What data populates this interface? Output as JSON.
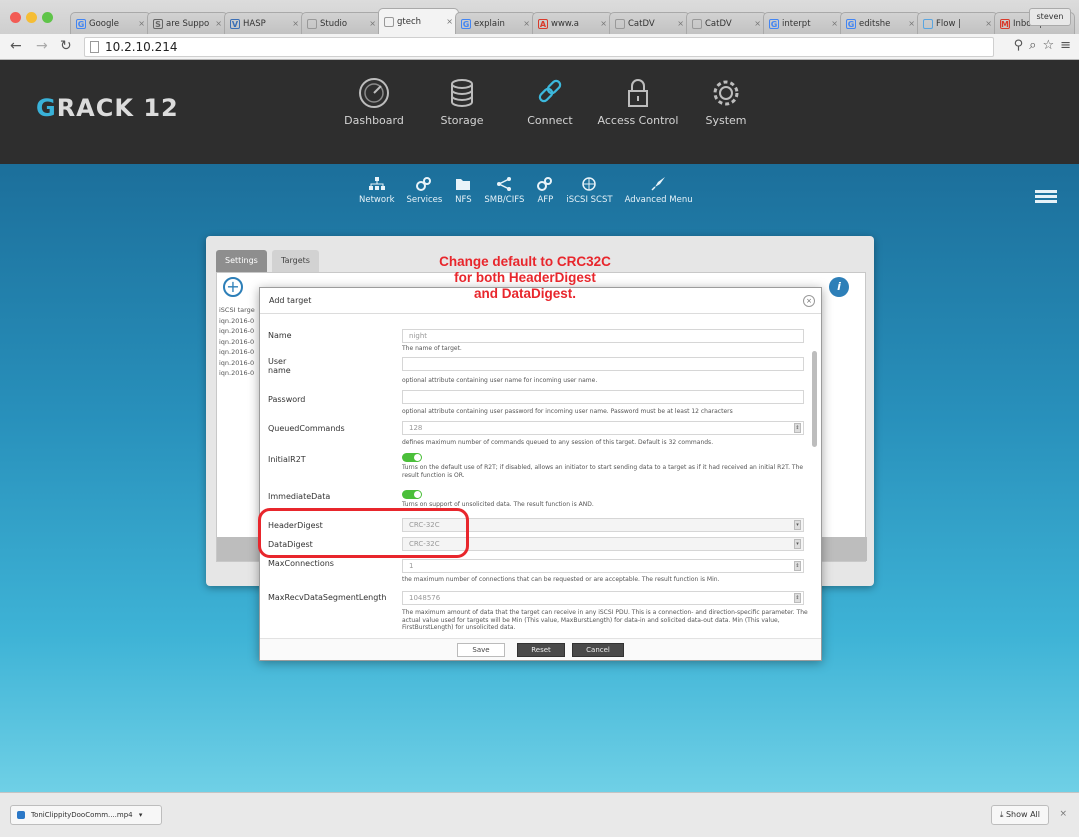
{
  "browser": {
    "tabs": [
      {
        "label": "Google",
        "fav": "G",
        "color": "#4285f4"
      },
      {
        "label": "are Suppo",
        "fav": "S",
        "color": "#666666"
      },
      {
        "label": "HASP",
        "fav": "V",
        "color": "#3b6fb6"
      },
      {
        "label": "Studio",
        "fav": "",
        "color": "#999999"
      },
      {
        "label": "gtech",
        "fav": "",
        "color": "#999999"
      },
      {
        "label": "explain",
        "fav": "G",
        "color": "#4285f4"
      },
      {
        "label": "www.a",
        "fav": "A",
        "color": "#d93a2b"
      },
      {
        "label": "CatDV",
        "fav": "",
        "color": "#999999"
      },
      {
        "label": "CatDV",
        "fav": "",
        "color": "#999999"
      },
      {
        "label": "interpt",
        "fav": "G",
        "color": "#4285f4"
      },
      {
        "label": "editshe",
        "fav": "G",
        "color": "#4285f4"
      },
      {
        "label": "Flow |",
        "fav": "",
        "color": "#5aa5e0"
      },
      {
        "label": "Inbox |",
        "fav": "M",
        "color": "#d93a2b"
      }
    ],
    "active_tab": 4,
    "profile": "steven",
    "url": "10.2.10.214"
  },
  "app": {
    "logo_g": "G",
    "logo_rest": "RACK 12",
    "main_nav": [
      {
        "label": "Dashboard",
        "icon": "dashboard-icon"
      },
      {
        "label": "Storage",
        "icon": "storage-icon"
      },
      {
        "label": "Connect",
        "icon": "connect-icon"
      },
      {
        "label": "Access Control",
        "icon": "lock-icon"
      },
      {
        "label": "System",
        "icon": "gear-icon"
      }
    ],
    "sub_nav": [
      {
        "label": "Network",
        "icon": "network-icon"
      },
      {
        "label": "Services",
        "icon": "services-icon"
      },
      {
        "label": "NFS",
        "icon": "nfs-icon"
      },
      {
        "label": "SMB/CIFS",
        "icon": "smb-icon"
      },
      {
        "label": "AFP",
        "icon": "afp-icon"
      },
      {
        "label": "iSCSI SCST",
        "icon": "globe-icon"
      },
      {
        "label": "Advanced Menu",
        "icon": "rocket-icon"
      }
    ]
  },
  "background_panel": {
    "tabs": [
      "Settings",
      "Targets"
    ],
    "plus": "+",
    "info": "i",
    "targets": [
      "iSCSI targe",
      "iqn.2016-0",
      "iqn.2016-0",
      "iqn.2016-0",
      "iqn.2016-0",
      "iqn.2016-0",
      "iqn.2016-0"
    ]
  },
  "modal": {
    "title": "Add target",
    "close": "×",
    "fields": {
      "name": {
        "label": "Name",
        "value": "night",
        "help": "The name of target."
      },
      "username": {
        "label": "User name",
        "value": "",
        "help": "optional attribute containing user name for incoming user name."
      },
      "password": {
        "label": "Password",
        "value": "",
        "help": "optional attribute containing user password for incoming user name. Password must be at least 12 characters"
      },
      "queued": {
        "label": "QueuedCommands",
        "value": "128",
        "help": "defines maximum number of commands queued to any session of this target. Default is 32 commands."
      },
      "initialr2t": {
        "label": "InitialR2T",
        "help": "Turns on the default use of R2T; if disabled, allows an initiator to start sending data to a target as if it had received an initial R2T. The result function is OR."
      },
      "immediate": {
        "label": "ImmediateData",
        "help": "Turns on support of unsolicited data. The result function is AND."
      },
      "header_digest": {
        "label": "HeaderDigest",
        "value": "CRC-32C"
      },
      "data_digest": {
        "label": "DataDigest",
        "value": "CRC-32C"
      },
      "max_conn": {
        "label": "MaxConnections",
        "value": "1",
        "help": "the maximum number of connections that can be requested or are acceptable. The result function is Min."
      },
      "max_recv": {
        "label": "MaxRecvDataSegmentLength",
        "value": "1048576",
        "help": "The maximum amount of data that the target can receive in any iSCSI PDU. This is a connection- and direction-specific parameter. The actual value used for targets will be Min (This value, MaxBurstLength) for data-in and solicited data-out data. Min (This value, FirstBurstLength) for unsolicited data."
      }
    },
    "buttons": {
      "save": "Save",
      "reset": "Reset",
      "cancel": "Cancel"
    }
  },
  "annotation": {
    "lines": [
      "Change default to CRC32C",
      "for both HeaderDigest",
      "and DataDigest."
    ],
    "color": "#e8262c"
  },
  "download": {
    "file": "ToniClippityDooComm....mp4",
    "show_all": "Show All",
    "close": "×"
  }
}
